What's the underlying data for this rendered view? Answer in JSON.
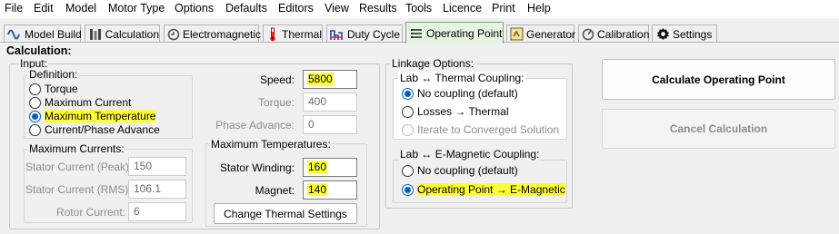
{
  "menu": [
    "File",
    "Edit",
    "Model",
    "Motor Type",
    "Options",
    "Defaults",
    "Editors",
    "View",
    "Results",
    "Tools",
    "Licence",
    "Print",
    "Help"
  ],
  "tabs": [
    {
      "label": "Model Build",
      "icon": "sine-wave-icon"
    },
    {
      "label": "Calculation",
      "icon": "calculator-icon"
    },
    {
      "label": "Electromagnetic",
      "icon": "magnet-icon"
    },
    {
      "label": "Thermal",
      "icon": "thermometer-icon"
    },
    {
      "label": "Duty Cycle",
      "icon": "duty-cycle-icon"
    },
    {
      "label": "Operating Point",
      "icon": "operating-point-icon",
      "active": true
    },
    {
      "label": "Generator",
      "icon": "generator-icon"
    },
    {
      "label": "Calibration",
      "icon": "calibration-icon"
    },
    {
      "label": "Settings",
      "icon": "gear-icon"
    }
  ],
  "panel": {
    "title": "Calculation:",
    "input_label": "Input:",
    "definition": {
      "legend": "Definition:",
      "options": [
        {
          "label": "Torque",
          "checked": false,
          "highlight": false
        },
        {
          "label": "Maximum Current",
          "checked": false,
          "highlight": false
        },
        {
          "label": "Maximum Temperature",
          "checked": true,
          "highlight": true
        },
        {
          "label": "Current/Phase Advance",
          "checked": false,
          "highlight": false
        }
      ]
    },
    "fields": {
      "speed": {
        "label": "Speed:",
        "value": "5800",
        "highlight": true
      },
      "torque": {
        "label": "Torque:",
        "value": "400",
        "disabled": true
      },
      "phase_advance": {
        "label": "Phase Advance:",
        "value": "0",
        "disabled": true
      }
    },
    "max_currents": {
      "legend": "Maximum Currents:",
      "stator_peak": {
        "label": "Stator Current (Peak):",
        "value": "150"
      },
      "stator_rms": {
        "label": "Stator Current (RMS):",
        "value": "106.1"
      },
      "rotor": {
        "label": "Rotor Current:",
        "value": "6"
      }
    },
    "max_temps": {
      "legend": "Maximum Temperatures:",
      "stator_winding": {
        "label": "Stator Winding:",
        "value": "160",
        "highlight": true
      },
      "magnet": {
        "label": "Magnet:",
        "value": "140",
        "highlight": true
      },
      "change_button": "Change Thermal Settings"
    },
    "linkage": {
      "legend": "Linkage Options:",
      "thermal": {
        "legend": "Lab ↔ Thermal Coupling:",
        "options": [
          {
            "label": "No coupling (default)",
            "checked": true,
            "disabled": false
          },
          {
            "label": "Losses → Thermal",
            "checked": false,
            "disabled": false
          },
          {
            "label": "Iterate to Converged Solution",
            "checked": false,
            "disabled": true
          }
        ]
      },
      "emag": {
        "legend": "Lab ↔ E-Magnetic Coupling:",
        "options": [
          {
            "label": "No coupling (default)",
            "checked": false,
            "highlight": false
          },
          {
            "label": "Operating Point → E-Magnetic",
            "checked": true,
            "highlight": true
          }
        ]
      }
    },
    "buttons": {
      "calculate": "Calculate Operating Point",
      "cancel": "Cancel Calculation"
    }
  },
  "colors": {
    "highlight": "#ffff33",
    "radio_checked": "#0060c0",
    "active_tab": "#e6f5e1"
  }
}
